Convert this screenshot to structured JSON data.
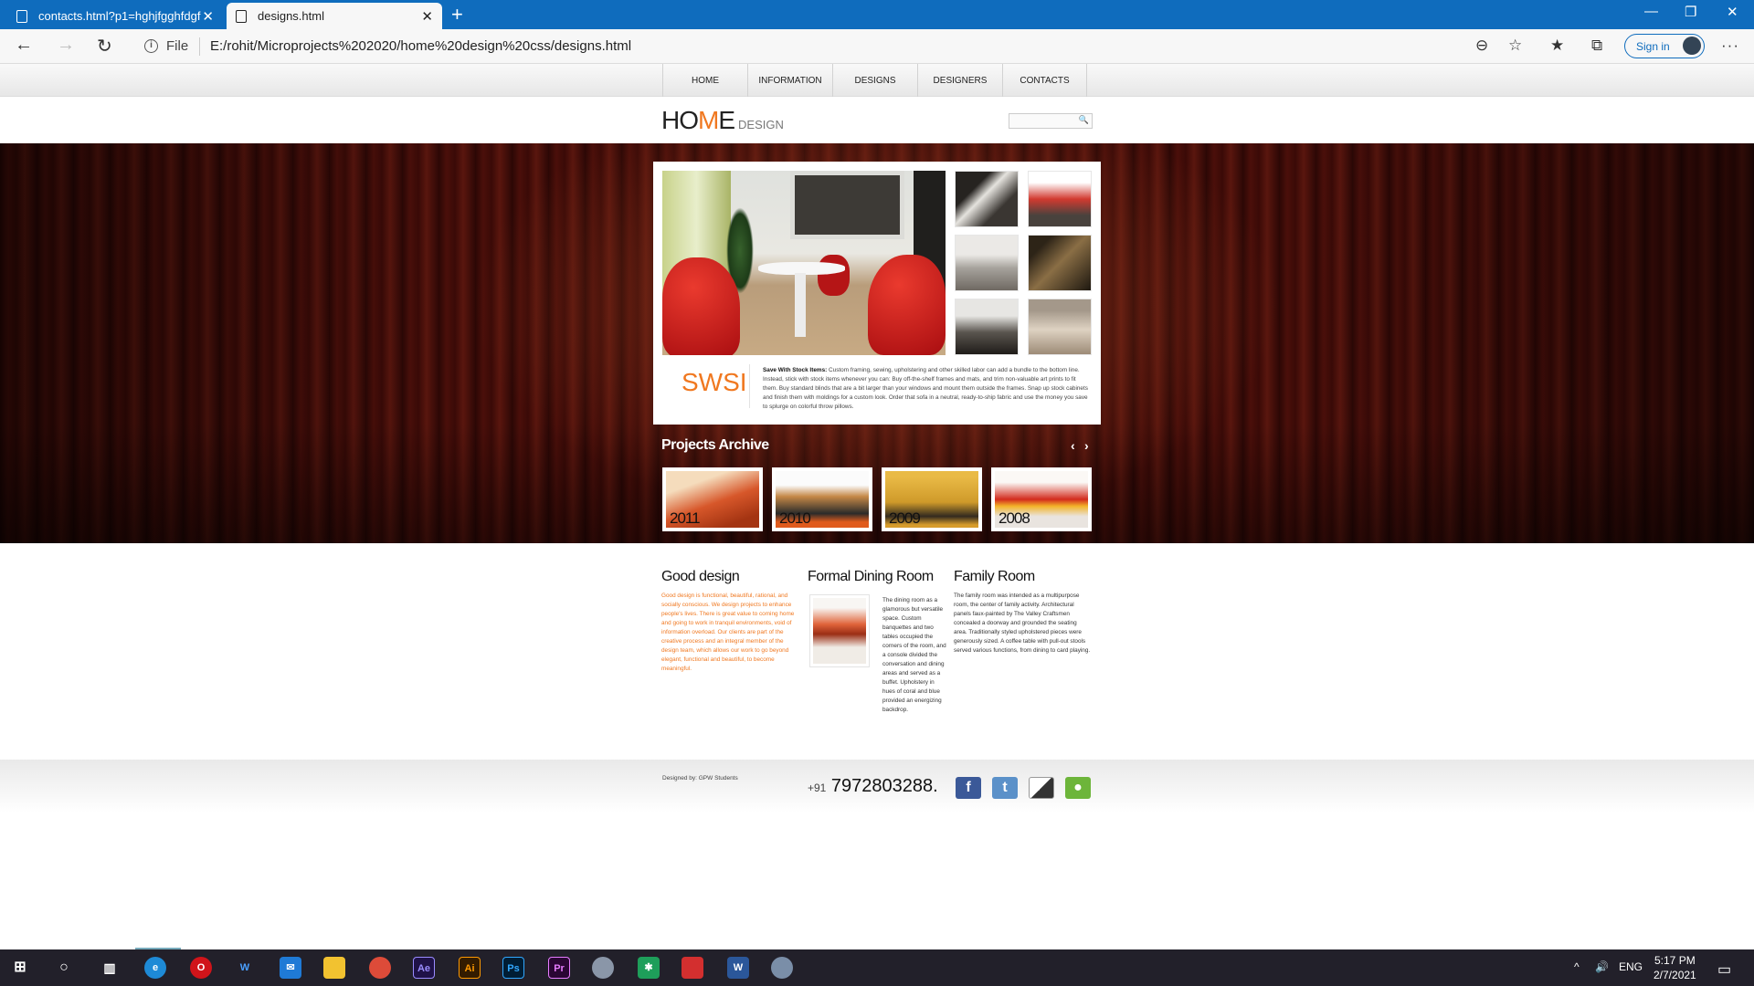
{
  "browser": {
    "tabs": [
      {
        "title": "contacts.html?p1=hghjfgghfdgf"
      },
      {
        "title": "designs.html"
      }
    ],
    "file_label": "File",
    "url": "E:/rohit/Microprojects%202020/home%20design%20css/designs.html",
    "signin_label": "Sign in"
  },
  "site": {
    "nav": [
      "HOME",
      "INFORMATION",
      "DESIGNS",
      "DESIGNERS",
      "CONTACTS"
    ],
    "logo": {
      "ho": "HO",
      "m": "M",
      "e": "E",
      "design": "DESIGN"
    },
    "feature": {
      "brand": "SWSI",
      "lead": "Save With Stock Items:",
      "text": " Custom framing, sewing, upholstering and other skilled labor can add a bundle to the bottom line. Instead, stick with stock items whenever you can: Buy off-the-shelf frames and mats, and trim non-valuable art prints to fit them. Buy standard blinds that are a bit larger than your windows and mount them outside the frames. Snap up stock cabinets and finish them with moldings for a custom look. Order that sofa in a neutral, ready-to-ship fabric and use the money you save to splurge on colorful throw pillows."
    },
    "projects_archive": {
      "title": "Projects Archive",
      "years": [
        "2011",
        "2010",
        "2009",
        "2008"
      ]
    },
    "columns": [
      {
        "title": "Good design",
        "text": "Good design is functional, beautiful, rational, and socially conscious. We design projects to enhance people's lives. There is great value to coming home and going to work in tranquil environments, void of information overload. Our clients are part of the creative process and an integral member of the design team, which allows our work to go beyond elegant, functional and beautiful, to become meaningful."
      },
      {
        "title": "Formal Dining Room",
        "text": "The dining room as a glamorous but versatile space. Custom banquettes and two tables occupied the corners of the room, and a console divided the conversation and dining areas and served as a buffet. Upholstery in hues of coral and blue provided an energizing backdrop."
      },
      {
        "title": "Family Room",
        "text": "The family room was intended as a multipurpose room, the center of family activity. Architectural panels faux-painted by The Valley Craftsmen concealed a doorway and grounded the seating area. Traditionally styled upholstered pieces were generously sized. A coffee table with pull-out stools served various functions, from dining to card playing."
      }
    ],
    "footer": {
      "credit": "Designed by: GPW Students",
      "phone_prefix": "+91",
      "phone": "7972803288."
    }
  },
  "taskbar": {
    "lang": "ENG",
    "time": "5:17 PM",
    "date": "2/7/2021"
  },
  "colors": {
    "accent": "#f07820",
    "browser_blue": "#0f6cbd"
  }
}
